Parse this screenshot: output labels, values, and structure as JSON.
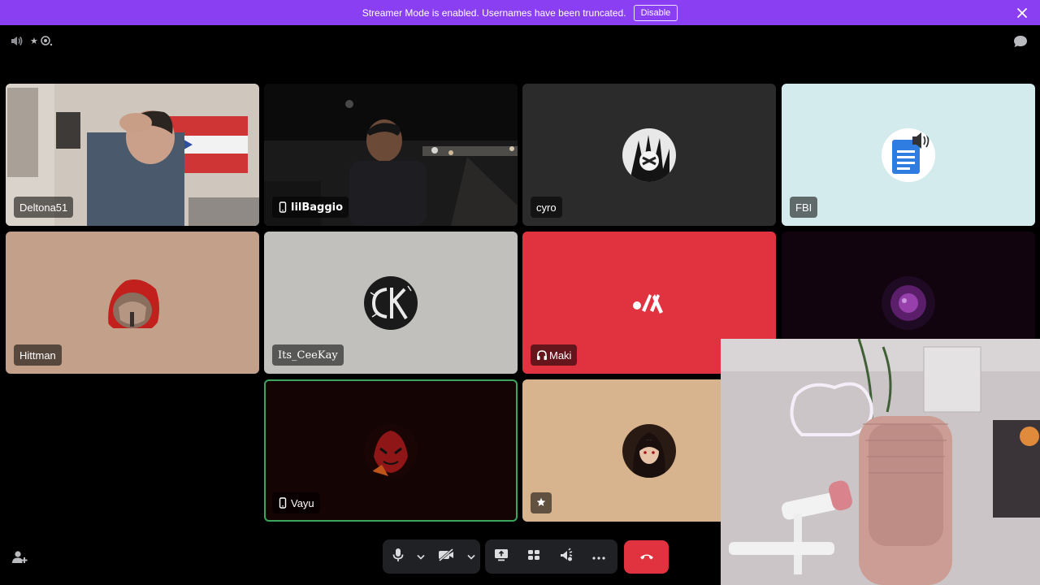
{
  "banner": {
    "message": "Streamer Mode is enabled. Usernames have been truncated.",
    "disable_label": "Disable"
  },
  "top": {
    "left_icons": [
      "speaker-icon",
      "activity-icon"
    ],
    "right_icons": [
      "chat-bubble-icon"
    ]
  },
  "participants": [
    {
      "name": "Deltona51",
      "type": "video",
      "indicator": null
    },
    {
      "name": "lilBaggio",
      "type": "video",
      "indicator": "mobile-icon"
    },
    {
      "name": "cyro",
      "type": "avatar",
      "indicator": null
    },
    {
      "name": "FBI",
      "type": "avatar",
      "indicator": null
    },
    {
      "name": "Hittman",
      "type": "avatar",
      "indicator": null
    },
    {
      "name": "Its_CeeKay",
      "type": "avatar",
      "indicator": null
    },
    {
      "name": "Maki",
      "type": "avatar",
      "indicator": "headset-icon"
    },
    {
      "name": "",
      "type": "avatar",
      "indicator": null
    },
    {
      "name": "Vayu",
      "type": "avatar",
      "indicator": "mobile-icon",
      "speaking": true
    },
    {
      "name": "",
      "type": "avatar",
      "indicator": "star-icon"
    }
  ],
  "controls": {
    "buttons": [
      "microphone-icon",
      "chevron-down-icon",
      "camera-off-icon",
      "chevron-down-icon",
      "screen-share-icon",
      "activities-icon",
      "soundboard-icon",
      "more-icon",
      "end-call-icon"
    ]
  },
  "colors": {
    "banner": "#8a3ff2",
    "speaking_border": "#3ba55d",
    "end_call": "#e0323f",
    "maki_tile": "#e0323f",
    "fbi_tile": "#d4ebee"
  }
}
